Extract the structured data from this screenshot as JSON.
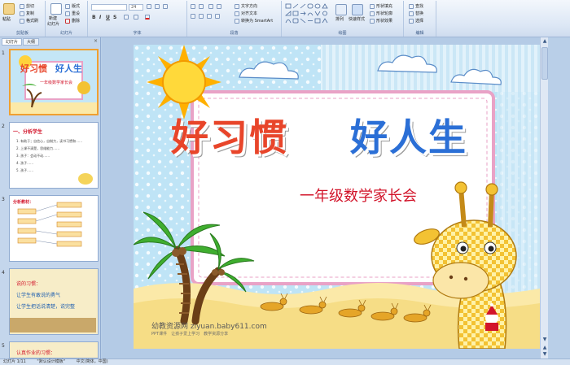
{
  "ribbon": {
    "clipboard": {
      "paste": "粘贴",
      "cut": "剪切",
      "copy": "复制",
      "format_painter": "格式刷",
      "label": "剪贴板"
    },
    "slides": {
      "new_slide": "新建",
      "new_slide2": "幻灯片",
      "layout": "版式",
      "reset": "重设",
      "delete": "删除",
      "label": "幻灯片"
    },
    "font": {
      "font_name": "",
      "font_size": "24",
      "label": "字体"
    },
    "paragraph": {
      "text_direction": "文字方向",
      "align_text": "对齐文本",
      "smartart": "转换为 SmartArt",
      "label": "段落"
    },
    "drawing": {
      "arrange": "排列",
      "quick_styles": "快速样式",
      "shape_fill": "形状填充",
      "shape_outline": "形状轮廓",
      "shape_effects": "形状效果",
      "label": "绘图"
    },
    "editing": {
      "find": "查找",
      "replace": "替换",
      "select": "选择",
      "label": "编辑"
    }
  },
  "pane": {
    "tabs": [
      "幻灯片",
      "大纲"
    ],
    "close": "×",
    "thumbs": [
      {
        "num": "1",
        "title_a": "好习惯",
        "title_b": "好人生",
        "subtitle": "一年级数学家长会"
      },
      {
        "num": "2",
        "title": "一、分析学生",
        "lines": [
          "1. 有助于；自信心，自制力，读书习惯和……",
          "2. 上课不清楚，思维能力……",
          "3. 孩子：会动不动……",
          "4. 孩子……",
          "5. 孩子……"
        ]
      },
      {
        "num": "3",
        "title": "分析教材："
      },
      {
        "num": "4",
        "lines": [
          "说的习惯：",
          "让学生有敢说的勇气",
          "让学生把话说清楚，说完整"
        ]
      },
      {
        "num": "5",
        "title": "认真作业的习惯："
      }
    ]
  },
  "slide": {
    "title_a": "好习惯",
    "title_b": "好人生",
    "subtitle": "一年级数学家长会",
    "watermark": "幼教资源网 ziyuan.baby611.com",
    "watermark_small": "PPT课件　让孩子爱上学习　教学资源分享　"
  },
  "status": {
    "slide": "幻灯片 1/11",
    "theme": "\"默认设计模板\"",
    "lang": "中文(简体，中国)"
  },
  "colors": {
    "title_a": "#e8452a",
    "title_b": "#2b6fd6",
    "subtitle": "#d2142a",
    "frame": "#e9a2c6"
  }
}
